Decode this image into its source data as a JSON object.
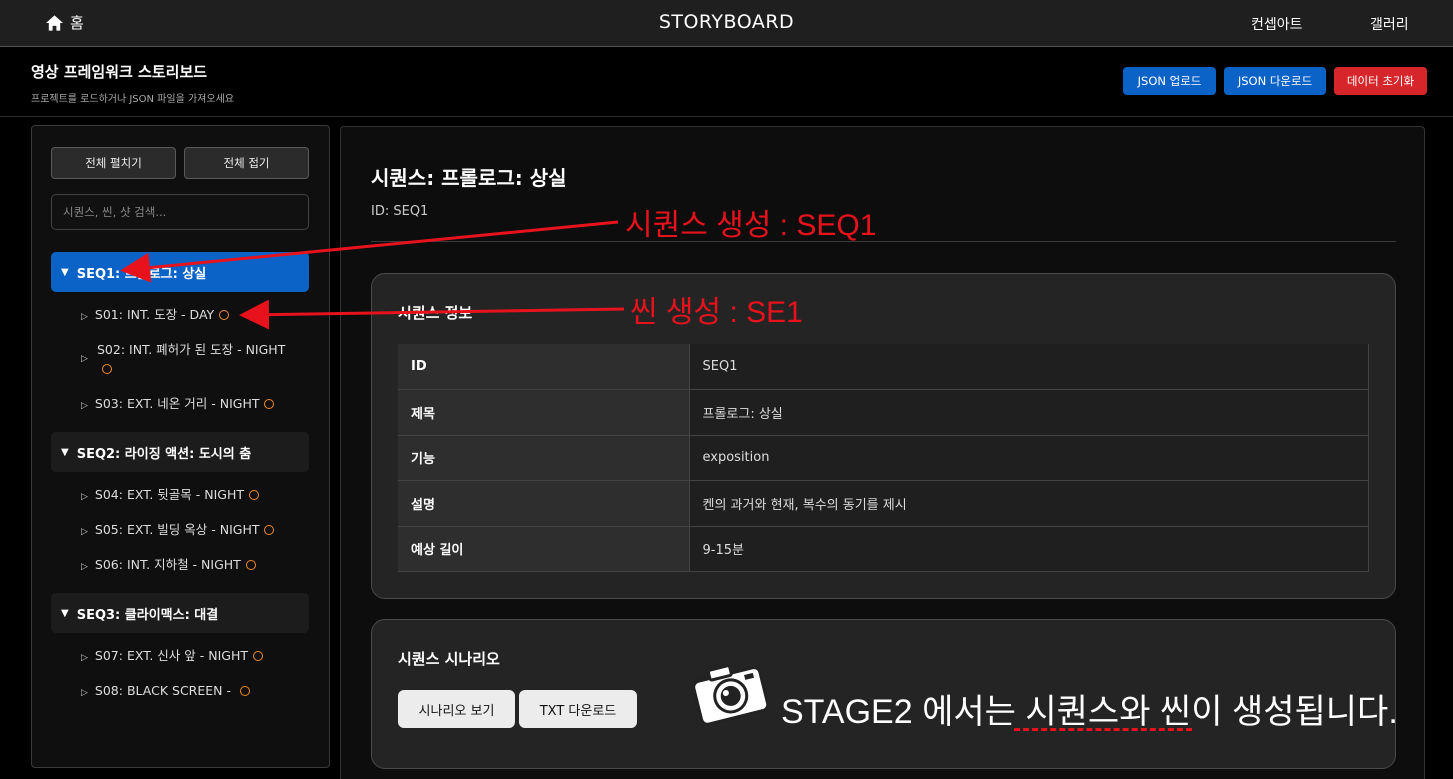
{
  "topbar": {
    "home_label": "홈",
    "brand": "STORYBOARD",
    "nav": [
      "컨셉아트",
      "갤러리"
    ]
  },
  "header": {
    "title": "영상 프레임워크 스토리보드",
    "subtitle": "프로젝트를 로드하거나 JSON 파일을 가져오세요",
    "buttons": {
      "upload": "JSON 업로드",
      "download": "JSON 다운로드",
      "reset": "데이터 초기화"
    }
  },
  "sidebar": {
    "expand_all": "전체 펼치기",
    "collapse_all": "전체 접기",
    "search_placeholder": "시퀀스, 씬, 샷 검색...",
    "sequences": [
      {
        "label": "SEQ1: 프롤로그: 상실",
        "active": true,
        "scenes": [
          "S01: INT. 도장 - DAY",
          "S02: INT. 폐허가 된 도장 - NIGHT",
          "S03: EXT. 네온 거리 - NIGHT"
        ]
      },
      {
        "label": "SEQ2: 라이징 액션: 도시의 춤",
        "active": false,
        "scenes": [
          "S04: EXT. 뒷골목 - NIGHT",
          "S05: EXT. 빌딩 옥상 - NIGHT",
          "S06: INT. 지하철 - NIGHT"
        ]
      },
      {
        "label": "SEQ3: 클라이맥스: 대결",
        "active": false,
        "scenes": [
          "S07: EXT. 신사 앞 - NIGHT",
          "S08: BLACK SCREEN -"
        ]
      }
    ]
  },
  "main": {
    "title": "시퀀스: 프롤로그: 상실",
    "id_line": "ID: SEQ1",
    "info_card": {
      "title": "시퀀스 정보",
      "rows": [
        {
          "key": "ID",
          "value": "SEQ1"
        },
        {
          "key": "제목",
          "value": "프롤로그: 상실"
        },
        {
          "key": "기능",
          "value": "exposition"
        },
        {
          "key": "설명",
          "value": "켄의 과거와 현재, 복수의 동기를 제시"
        },
        {
          "key": "예상 길이",
          "value": "9-15분"
        }
      ]
    },
    "scenario_card": {
      "title": "시퀀스 시나리오",
      "view_button": "시나리오 보기",
      "txt_button": "TXT 다운로드"
    }
  },
  "annotations": {
    "seq_note": "시퀀스 생성 : SEQ1",
    "scene_note": "씬 생성 : SE1",
    "stage_note": "STAGE2 에서는 시퀀스와 씬이 생성됩니다.",
    "color": "#e8121c"
  },
  "colors": {
    "accent_blue": "#0b63c8",
    "danger_red": "#d7262b",
    "status_ring": "#f08a2e"
  }
}
